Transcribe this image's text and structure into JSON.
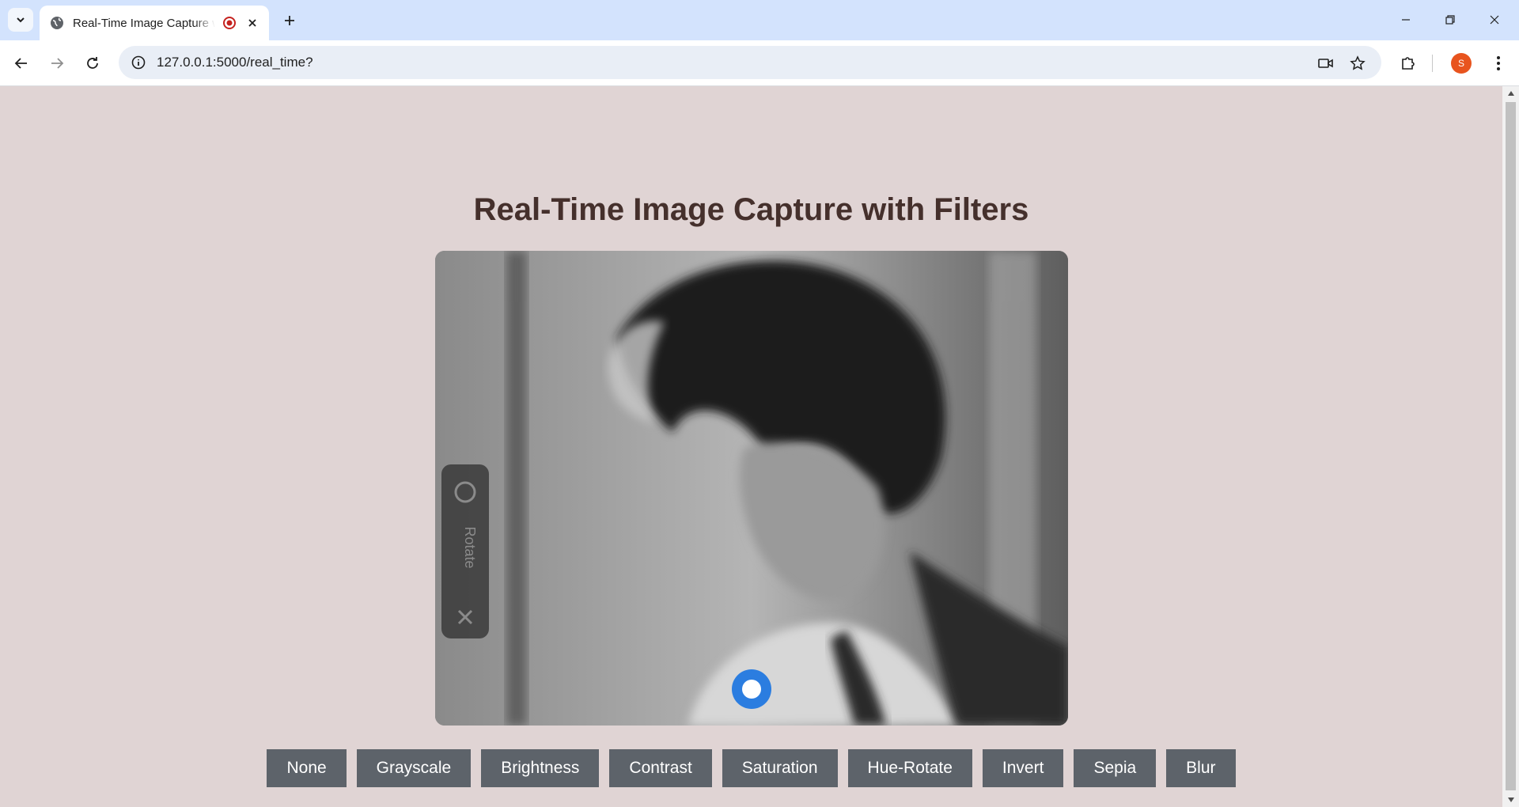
{
  "browser": {
    "tab_title": "Real-Time Image Capture with Filters",
    "url": "127.0.0.1:5000/real_time?",
    "profile_initial": "S",
    "profile_color": "#e8541e"
  },
  "page": {
    "title": "Real-Time Image Capture with Filters",
    "background": "#e0d4d4"
  },
  "video": {
    "overlay_label": "Rotate"
  },
  "filters": [
    {
      "label": "None"
    },
    {
      "label": "Grayscale"
    },
    {
      "label": "Brightness"
    },
    {
      "label": "Contrast"
    },
    {
      "label": "Saturation"
    },
    {
      "label": "Hue-Rotate"
    },
    {
      "label": "Invert"
    },
    {
      "label": "Sepia"
    },
    {
      "label": "Blur"
    }
  ],
  "colors": {
    "accent": "#2b7de0",
    "filter_button": "#5d636a",
    "title_text": "#45302c"
  }
}
